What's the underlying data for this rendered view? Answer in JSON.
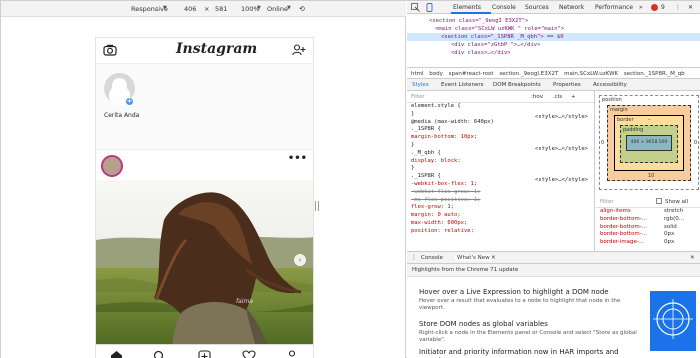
{
  "device_toolbar": {
    "device": "Responsive",
    "width": "406",
    "height": "581",
    "zoom": "100%",
    "network": "Online"
  },
  "instagram": {
    "logo": "Instagram",
    "story_label": "Cerita Anda",
    "watermark": "faima"
  },
  "devtools": {
    "tabs": [
      "Elements",
      "Console",
      "Sources",
      "Network",
      "Performance"
    ],
    "error_count": "9",
    "dom_lines": [
      "<section class=\"_9eogI E3X2T\">",
      "<main class=\"SCxLW uzKWK \" role=\"main\">",
      "<section class=\"_1SP8R _M_qbh\"> == $0",
      "<div class=\"zGtbP \">…</div>",
      "<div class>…</div>"
    ],
    "breadcrumbs": [
      "html",
      "body",
      "span#react-root",
      "section._9eogI.E3X2T",
      "main.SCxLW.uzKWK",
      "section._1SP8R._M_qb"
    ],
    "subtabs": [
      "Styles",
      "Event Listeners",
      "DOM Breakpoints",
      "Properties",
      "Accessibility"
    ],
    "filter_placeholder": "Filter",
    "filter_buttons": [
      ":hov",
      ".cls",
      "+"
    ],
    "styles_lines": [
      {
        "text": "element.style {",
        "src": ""
      },
      {
        "text": "}",
        "src": ""
      },
      {
        "text": "@media (max-width: 640px)",
        "src": ""
      },
      {
        "text": "._1SP8R {",
        "src": "<style>…</style>"
      },
      {
        "text": "  margin-bottom: 10px;",
        "src": ""
      },
      {
        "text": "}",
        "src": ""
      },
      {
        "text": "._M_qbh {",
        "src": "<style>…</style>"
      },
      {
        "text": "  display: block;",
        "src": ""
      },
      {
        "text": "}",
        "src": ""
      },
      {
        "text": "._1SP8R {",
        "src": "<style>…</style>"
      },
      {
        "text": "  -webkit-box-flex: 1;",
        "src": ""
      },
      {
        "text": "  -webkit-flex-grow: 1;",
        "src": ""
      },
      {
        "text": "  -ms-flex-positive: 1;",
        "src": ""
      },
      {
        "text": "  flex-grow: 1;",
        "src": ""
      },
      {
        "text": "  margin: 0 auto;",
        "src": ""
      },
      {
        "text": "  max-width: 600px;",
        "src": ""
      },
      {
        "text": "  position: relative;",
        "src": ""
      }
    ],
    "box_model": {
      "position": "position",
      "margin": "margin",
      "border": "border",
      "padding": "padding",
      "content": "406 × 9658.500",
      "margin_bottom": "10",
      "side": "0",
      "dash": "–"
    },
    "computed_filter": "Filter",
    "show_all": "Show all",
    "computed": [
      {
        "prop": "align-items",
        "val": "stretch"
      },
      {
        "prop": "border-bottom-…",
        "val": "rgb(0…"
      },
      {
        "prop": "border-bottom-…",
        "val": "solid"
      },
      {
        "prop": "border-bottom-…",
        "val": "0px"
      },
      {
        "prop": "border-image-…",
        "val": "0px"
      }
    ],
    "drawer_tabs": [
      "Console",
      "What's New"
    ],
    "whats_new_header": "Highlights from the Chrome 71 update",
    "whats_new_items": [
      {
        "title": "Hover over a Live Expression to highlight a DOM node",
        "desc": "Hover over a result that evaluates to a node to highlight that node in the viewport."
      },
      {
        "title": "Store DOM nodes as global variables",
        "desc": "Right-click a node in the Elements panel or Console and select \"Store as global variable\"."
      },
      {
        "title": "Initiator and priority information now in HAR imports and exports",
        "desc": ""
      }
    ]
  },
  "colors": {
    "accent": "#1a73e8",
    "instagram_blue": "#3897f0",
    "error_red": "#d93025"
  }
}
